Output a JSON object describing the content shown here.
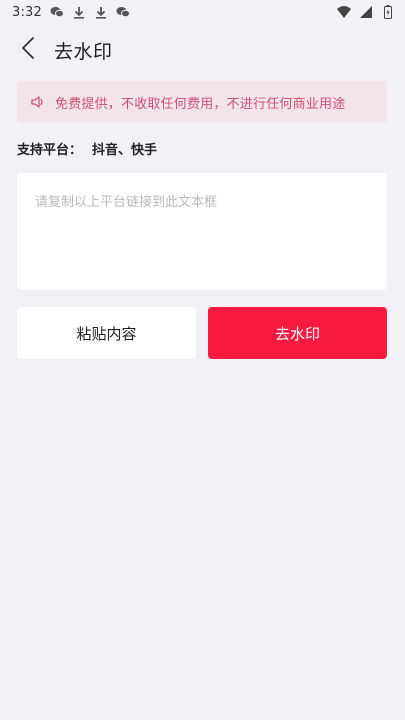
{
  "status_bar": {
    "time": "3:32",
    "left_icons": [
      "wechat-icon",
      "download-icon",
      "download-icon",
      "wechat-icon"
    ],
    "right_icons": [
      "wifi-icon",
      "signal-icon",
      "battery-icon"
    ]
  },
  "header": {
    "back_icon": "chevron-left-icon",
    "title": "去水印"
  },
  "notice": {
    "icon": "speaker-icon",
    "text": "免费提供，不收取任何费用，不进行任何商业用途",
    "color": "#d14f73",
    "background": "#f3e4ea"
  },
  "platforms": {
    "label": "支持平台：",
    "list": "抖音、快手"
  },
  "link_input": {
    "value": "",
    "placeholder": "请复制以上平台链接到此文本框"
  },
  "actions": {
    "paste_label": "粘贴内容",
    "remove_label": "去水印",
    "remove_color": "#fa1a3f"
  },
  "colors": {
    "page_background": "#f1f1f7",
    "card_background": "#ffffff"
  }
}
